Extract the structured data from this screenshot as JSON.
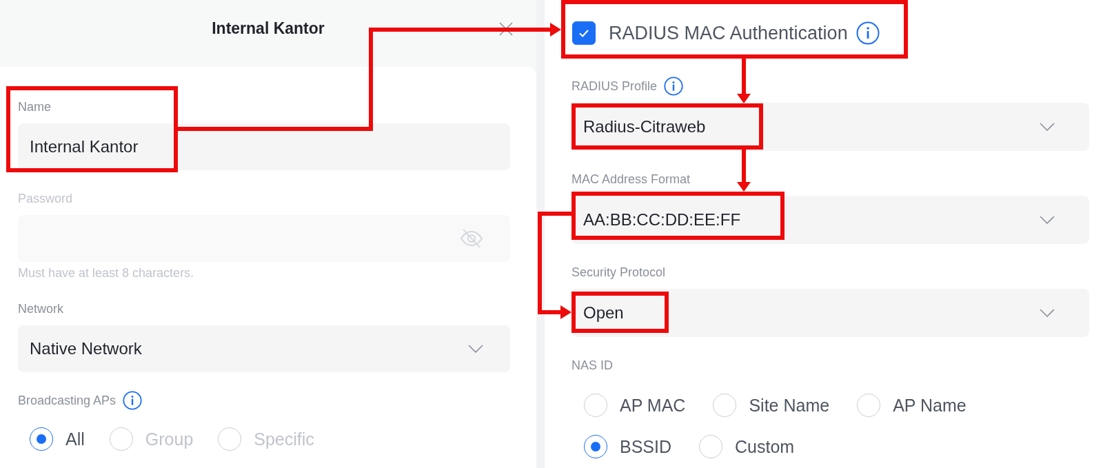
{
  "dialog": {
    "title": "Internal Kantor"
  },
  "left_fields": [
    {
      "kind": "text",
      "label": "Name",
      "value": "Internal Kantor",
      "disabled": false
    },
    {
      "kind": "password",
      "label": "Password",
      "disabled": true,
      "hint": "Must have at least 8 characters."
    },
    {
      "kind": "select",
      "label": "Network",
      "value": "Native Network",
      "disabled": false
    },
    {
      "kind": "radio",
      "label": "Broadcasting APs",
      "info": true,
      "option_rows": [
        [
          {
            "label": "All",
            "selected": true,
            "disabled": false
          },
          {
            "label": "Group",
            "selected": false,
            "disabled": true
          },
          {
            "label": "Specific",
            "selected": false,
            "disabled": true
          }
        ]
      ]
    }
  ],
  "radius_mac": {
    "label": "RADIUS MAC Authentication",
    "checked": true,
    "info": true
  },
  "right_fields": [
    {
      "kind": "select",
      "label": "RADIUS Profile",
      "info": true,
      "value": "Radius-Citraweb",
      "disabled": false
    },
    {
      "kind": "select",
      "label": "MAC Address Format",
      "value": "AA:BB:CC:DD:EE:FF",
      "disabled": false
    },
    {
      "kind": "select",
      "label": "Security Protocol",
      "value": "Open",
      "disabled": false
    },
    {
      "kind": "radio",
      "label": "NAS ID",
      "option_rows": [
        [
          {
            "label": "AP MAC",
            "selected": false,
            "disabled": false
          },
          {
            "label": "Site Name",
            "selected": false,
            "disabled": false
          },
          {
            "label": "AP Name",
            "selected": false,
            "disabled": false
          }
        ],
        [
          {
            "label": "BSSID",
            "selected": true,
            "disabled": false
          },
          {
            "label": "Custom",
            "selected": false,
            "disabled": false
          }
        ]
      ]
    }
  ]
}
